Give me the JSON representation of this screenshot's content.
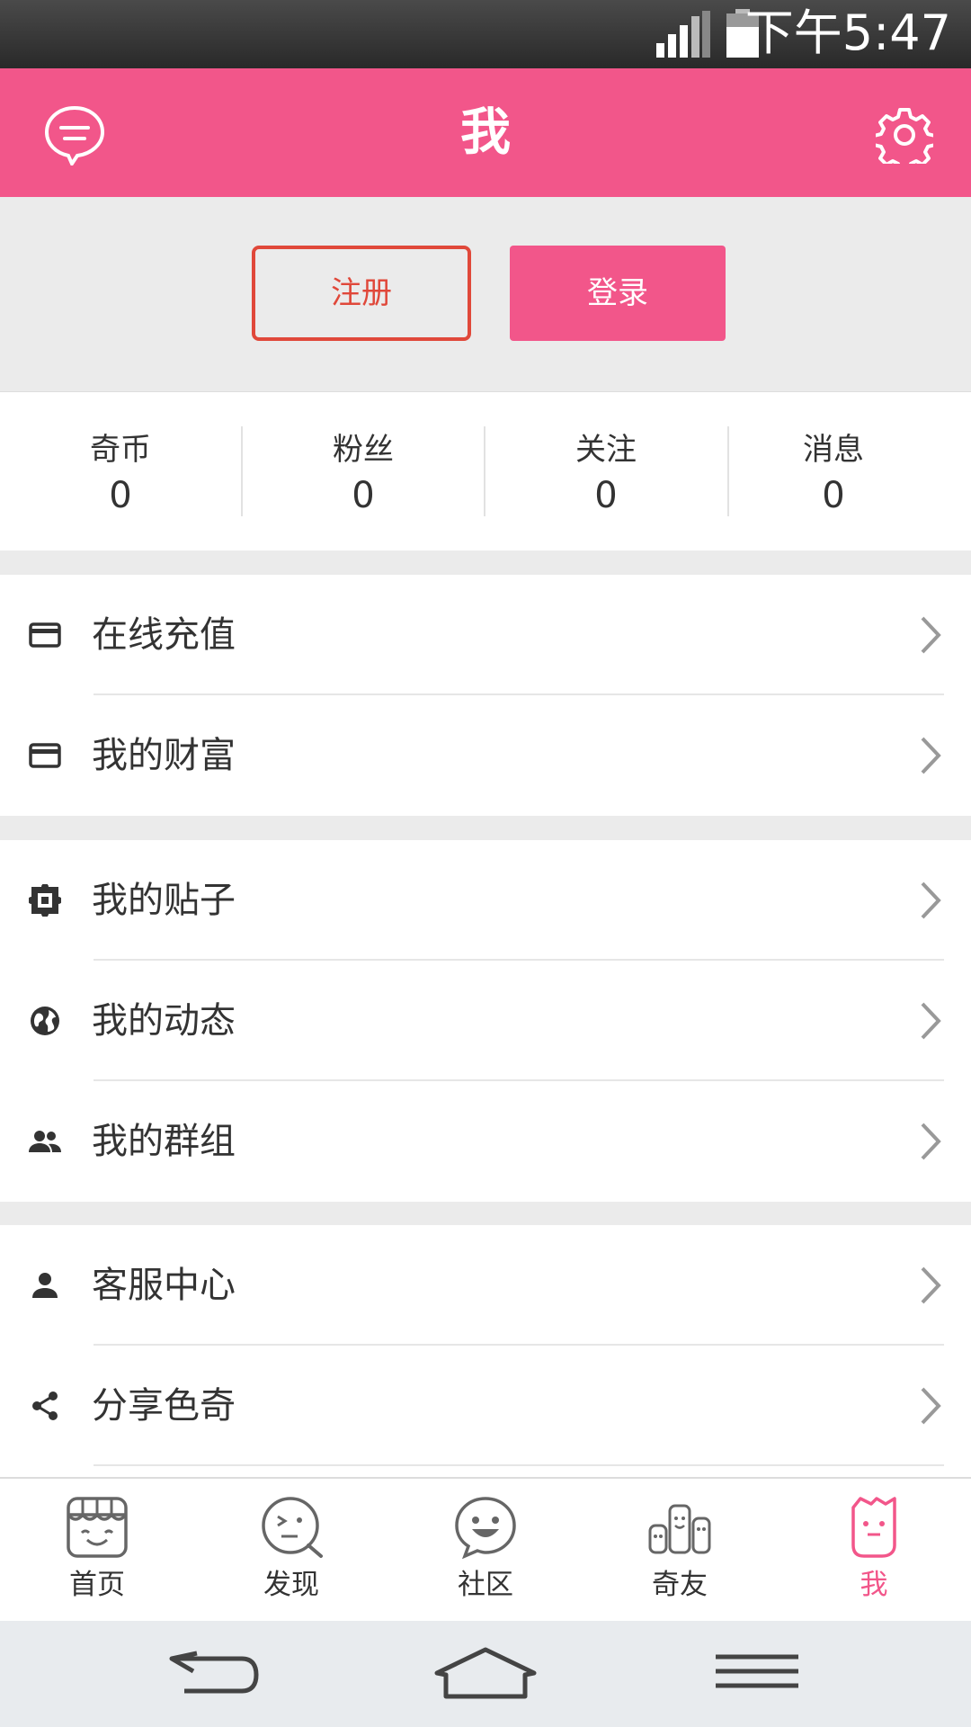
{
  "status_bar": {
    "time": "下午5:47"
  },
  "header": {
    "title": "我"
  },
  "auth": {
    "register_label": "注册",
    "login_label": "登录"
  },
  "stats": [
    {
      "label": "奇币",
      "value": "0"
    },
    {
      "label": "粉丝",
      "value": "0"
    },
    {
      "label": "关注",
      "value": "0"
    },
    {
      "label": "消息",
      "value": "0"
    }
  ],
  "menu": {
    "recharge": "在线充值",
    "wealth": "我的财富",
    "posts": "我的贴子",
    "activity": "我的动态",
    "groups": "我的群组",
    "service": "客服中心",
    "share": "分享色奇"
  },
  "tabs": [
    {
      "label": "首页"
    },
    {
      "label": "发现"
    },
    {
      "label": "社区"
    },
    {
      "label": "奇友"
    },
    {
      "label": "我"
    }
  ],
  "colors": {
    "brand": "#f2568a",
    "register": "#e0483a"
  }
}
